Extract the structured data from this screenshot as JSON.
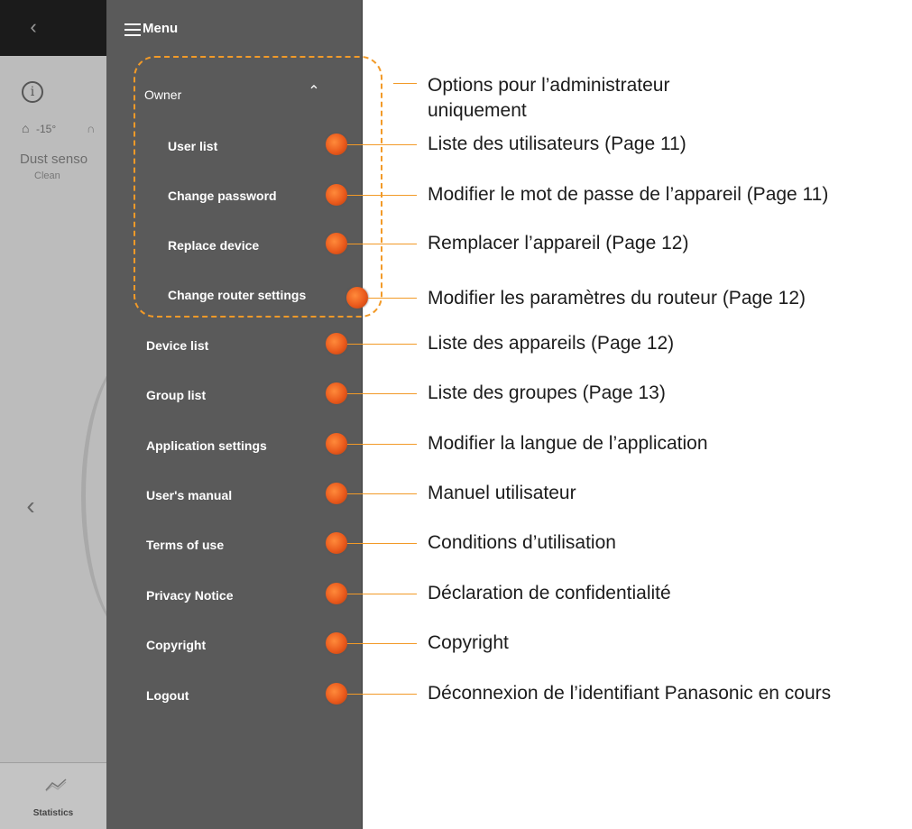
{
  "background": {
    "temperature": "-15°",
    "sensor_name": "Dust senso",
    "sensor_status": "Clean",
    "tab_label": "Statistics"
  },
  "menu": {
    "title": "Menu",
    "owner_label": "Owner",
    "owner_items": [
      "User list",
      "Change password",
      "Replace device",
      "Change router settings"
    ],
    "items": [
      "Device list",
      "Group list",
      "Application settings",
      "User's manual",
      "Terms of use",
      "Privacy Notice",
      "Copyright",
      "Logout"
    ]
  },
  "annotations": {
    "owner_options": [
      "Options pour l’administrateur",
      "uniquement"
    ],
    "owner_items": [
      "Liste des utilisateurs (Page 11)",
      "Modifier le mot de passe de l’appareil (Page 11)",
      "Remplacer l’appareil (Page 12)",
      "Modifier les paramètres du routeur (Page 12)"
    ],
    "items": [
      "Liste des appareils (Page 12)",
      "Liste des groupes (Page 13)",
      "Modifier la langue de l’application",
      "Manuel utilisateur",
      "Conditions d’utilisation",
      "Déclaration de confidentialité",
      "Copyright",
      "Déconnexion de l’identifiant Panasonic en cours"
    ]
  },
  "colors": {
    "drawer": "#5a5a5a",
    "accent": "#f29a28",
    "dot": "#ea5a1c",
    "background": "#bcbcbc"
  },
  "icons": [
    "back-icon",
    "info-icon",
    "home-icon",
    "humidity-icon",
    "prev-arrow-icon",
    "statistics-icon",
    "hamburger-icon",
    "chevron-up-icon"
  ]
}
